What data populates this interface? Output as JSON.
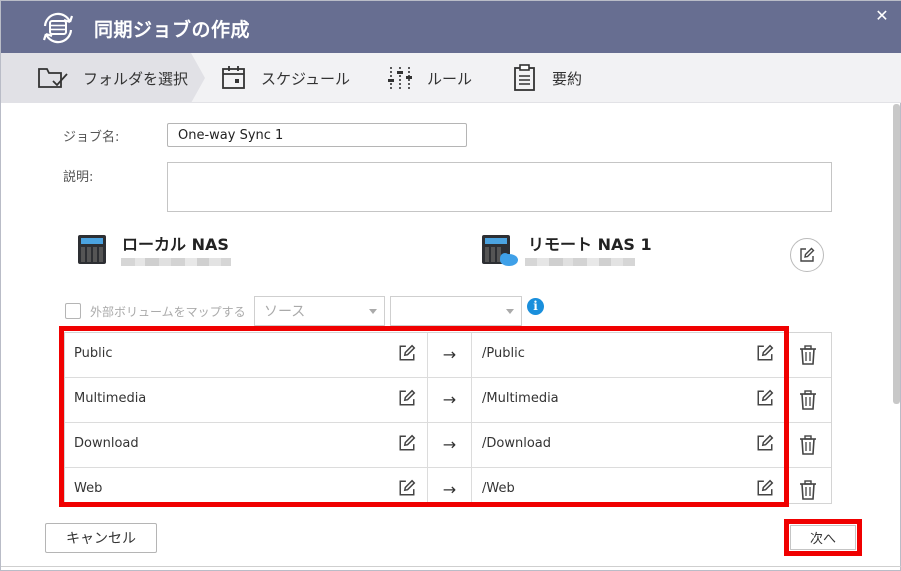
{
  "window": {
    "title": "同期ジョブの作成",
    "close_glyph": "✕",
    "accent_color": "#676e91"
  },
  "steps": [
    {
      "label": "フォルダを選択",
      "icon": "folder-check-icon",
      "active": true
    },
    {
      "label": "スケジュール",
      "icon": "calendar-icon",
      "active": false
    },
    {
      "label": "ルール",
      "icon": "sliders-icon",
      "active": false
    },
    {
      "label": "要約",
      "icon": "clipboard-icon",
      "active": false
    }
  ],
  "form": {
    "job_name_label": "ジョブ名:",
    "job_name_value": "One-way Sync 1",
    "description_label": "説明:",
    "description_value": ""
  },
  "local_nas": {
    "name": "ローカル NAS",
    "icon": "nas-device-icon"
  },
  "remote_nas": {
    "name": "リモート NAS 1",
    "icon": "nas-cloud-icon"
  },
  "map_volume": {
    "label": "外部ボリュームをマップする",
    "checked": false,
    "source_placeholder": "ソース",
    "second_select_value": ""
  },
  "folder_pairs": [
    {
      "source": "Public",
      "arrow": "→",
      "destination": "/Public"
    },
    {
      "source": "Multimedia",
      "arrow": "→",
      "destination": "/Multimedia"
    },
    {
      "source": "Download",
      "arrow": "→",
      "destination": "/Download"
    },
    {
      "source": "Web",
      "arrow": "→",
      "destination": "/Web"
    }
  ],
  "footer": {
    "cancel_label": "キャンセル",
    "next_label": "次へ"
  },
  "annotation_color": "#f00000"
}
